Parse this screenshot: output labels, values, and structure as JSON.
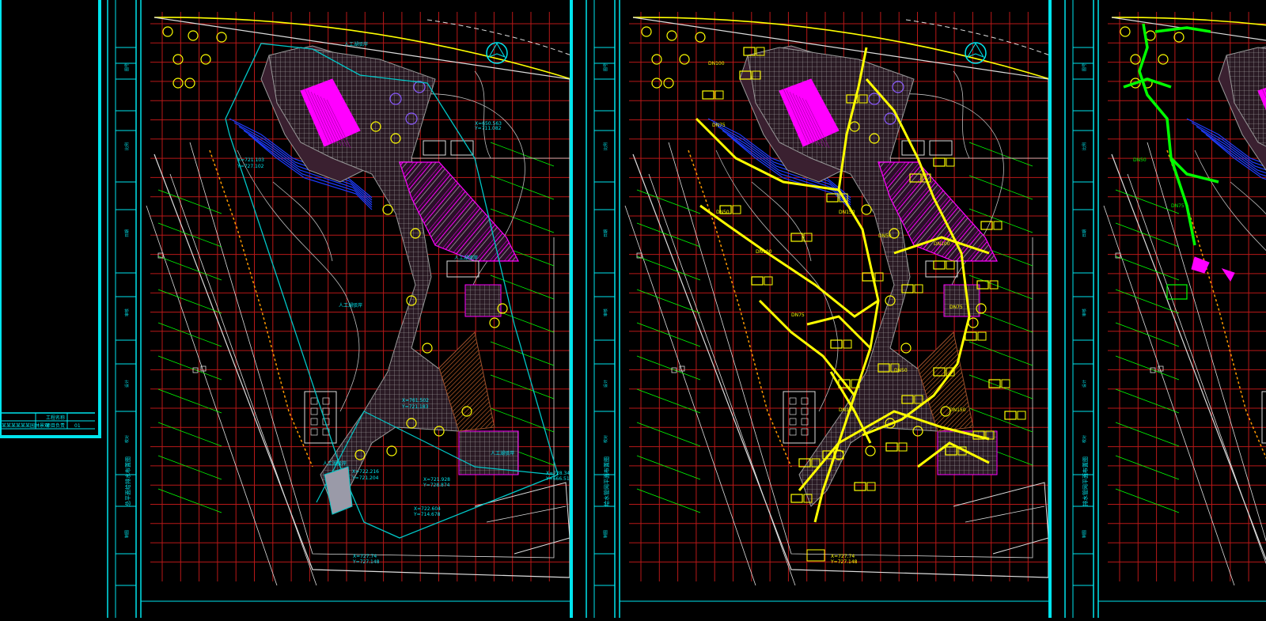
{
  "colors": {
    "background": "#000000",
    "frame": "#00e5ee",
    "grid": "#b81818",
    "boundary": "#dddddd",
    "contour": "#bfbfbf",
    "paving": "#9a9a9a",
    "magenta": "#ff00ff",
    "yellow": "#ffff00",
    "green": "#00ff00",
    "blue": "#1e3cff",
    "cyan_line": "#00c8c8",
    "hatch_brown": "#a0522d"
  },
  "left_title_block": {
    "cells": [
      "工程名称",
      "项目负责",
      "图号"
    ],
    "values": [
      "某某某某某某园林景观",
      "",
      "01"
    ]
  },
  "sheets": [
    {
      "id": "sheet-1",
      "network_color": "cyan",
      "labels": [
        {
          "text": "人工湖驳岸",
          "kind": "callout"
        },
        {
          "text": "人工湖驳岸",
          "kind": "callout"
        },
        {
          "text": "人工湖驳岸",
          "kind": "callout"
        },
        {
          "text": "人工湖驳岸",
          "kind": "callout"
        },
        {
          "text": "人工湖驳岸",
          "kind": "callout"
        },
        {
          "text": "X=721.103",
          "kind": "coord"
        },
        {
          "text": "Y=727.102",
          "kind": "coord"
        },
        {
          "text": "X=650.563",
          "kind": "coord"
        },
        {
          "text": "Y=711.082",
          "kind": "coord"
        },
        {
          "text": "X=761.502",
          "kind": "coord"
        },
        {
          "text": "Y=721.183",
          "kind": "coord"
        },
        {
          "text": "X=722.216",
          "kind": "coord"
        },
        {
          "text": "Y=721.204",
          "kind": "coord"
        },
        {
          "text": "X=721.928",
          "kind": "coord"
        },
        {
          "text": "Y=728.874",
          "kind": "coord"
        },
        {
          "text": "X=722.604",
          "kind": "coord"
        },
        {
          "text": "Y=714.678",
          "kind": "coord"
        },
        {
          "text": "X=728.340",
          "kind": "coord"
        },
        {
          "text": "Y=666.510",
          "kind": "coord"
        },
        {
          "text": "X=727.74",
          "kind": "coord"
        },
        {
          "text": "Y=727.148",
          "kind": "coord"
        }
      ]
    },
    {
      "id": "sheet-2",
      "network_color": "yellow",
      "labels": [
        {
          "text": "DN100",
          "kind": "pipe"
        },
        {
          "text": "DN75",
          "kind": "pipe"
        },
        {
          "text": "DN50",
          "kind": "pipe"
        },
        {
          "text": "DN100",
          "kind": "pipe"
        },
        {
          "text": "DN75",
          "kind": "pipe"
        },
        {
          "text": "DN150",
          "kind": "pipe"
        },
        {
          "text": "DN50",
          "kind": "pipe"
        },
        {
          "text": "DN100",
          "kind": "pipe"
        },
        {
          "text": "DN75",
          "kind": "pipe"
        },
        {
          "text": "DN50",
          "kind": "pipe"
        },
        {
          "text": "DN100",
          "kind": "pipe"
        },
        {
          "text": "DN150",
          "kind": "pipe"
        },
        {
          "text": "X=727.74",
          "kind": "coord"
        },
        {
          "text": "Y=727.148",
          "kind": "coord"
        }
      ]
    },
    {
      "id": "sheet-3",
      "network_color": "green",
      "labels": [
        {
          "text": "DN50",
          "kind": "pipe"
        },
        {
          "text": "DN75",
          "kind": "pipe"
        }
      ]
    }
  ],
  "sheet_titles": [
    "总平面给排水布置图",
    "给水管网平面布置图",
    "排水管网平面布置图"
  ],
  "strip_cells": [
    "图号",
    "比例",
    "日期",
    "审核",
    "设计",
    "校对",
    "制图"
  ]
}
